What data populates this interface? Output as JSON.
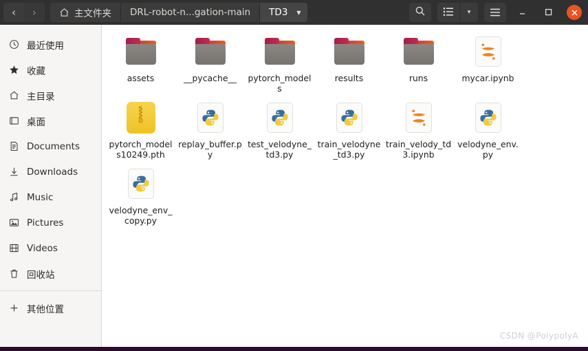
{
  "window": {
    "nav": {
      "back_label": "‹",
      "forward_label": "›"
    },
    "breadcrumbs": [
      {
        "label": "主文件夹",
        "icon": "home-icon",
        "current": false
      },
      {
        "label": "DRL-robot-n...gation-main",
        "icon": "",
        "current": false
      },
      {
        "label": "TD3",
        "icon": "",
        "current": true
      }
    ],
    "toolbar": {
      "search_label": "search-icon",
      "view_list_label": "list-view-icon",
      "view_dropdown_label": "▾",
      "menu_label": "hamburger-menu-icon"
    },
    "controls": {
      "minimize_label": "–",
      "maximize_label": "□",
      "close_label": "✕"
    },
    "accent_color": "#e95420",
    "titlebar_color": "#303030",
    "bottom_strip_color": "#2c0b2e"
  },
  "sidebar": {
    "items": [
      {
        "label": "最近使用",
        "icon": "clock-icon"
      },
      {
        "label": "收藏",
        "icon": "star-icon"
      },
      {
        "label": "主目录",
        "icon": "home-icon"
      },
      {
        "label": "桌面",
        "icon": "desktop-icon"
      },
      {
        "label": "Documents",
        "icon": "document-icon"
      },
      {
        "label": "Downloads",
        "icon": "download-icon"
      },
      {
        "label": "Music",
        "icon": "music-note-icon"
      },
      {
        "label": "Pictures",
        "icon": "picture-icon"
      },
      {
        "label": "Videos",
        "icon": "film-icon"
      },
      {
        "label": "回收站",
        "icon": "trash-icon"
      }
    ],
    "other_locations": {
      "label": "其他位置",
      "icon": "plus-icon"
    }
  },
  "files": [
    {
      "name": "assets",
      "type": "folder",
      "icon": "folder-icon"
    },
    {
      "name": "__pycache__",
      "type": "folder",
      "icon": "folder-icon"
    },
    {
      "name": "pytorch_models",
      "type": "folder",
      "icon": "folder-icon"
    },
    {
      "name": "results",
      "type": "folder",
      "icon": "folder-icon"
    },
    {
      "name": "runs",
      "type": "folder",
      "icon": "folder-icon"
    },
    {
      "name": "mycar.ipynb",
      "type": "notebook",
      "icon": "jupyter-icon"
    },
    {
      "name": "pytorch_models10249.pth",
      "type": "archive",
      "icon": "archive-icon"
    },
    {
      "name": "replay_buffer.py",
      "type": "python",
      "icon": "python-icon"
    },
    {
      "name": "test_velodyne_td3.py",
      "type": "python",
      "icon": "python-icon"
    },
    {
      "name": "train_velodyne_td3.py",
      "type": "python",
      "icon": "python-icon"
    },
    {
      "name": "train_velody_td3.ipynb",
      "type": "notebook",
      "icon": "jupyter-icon"
    },
    {
      "name": "velodyne_env.py",
      "type": "python",
      "icon": "python-icon"
    },
    {
      "name": "velodyne_env_copy.py",
      "type": "python",
      "icon": "python-icon"
    }
  ],
  "watermark": {
    "text": "CSDN @PoiypolyA"
  }
}
